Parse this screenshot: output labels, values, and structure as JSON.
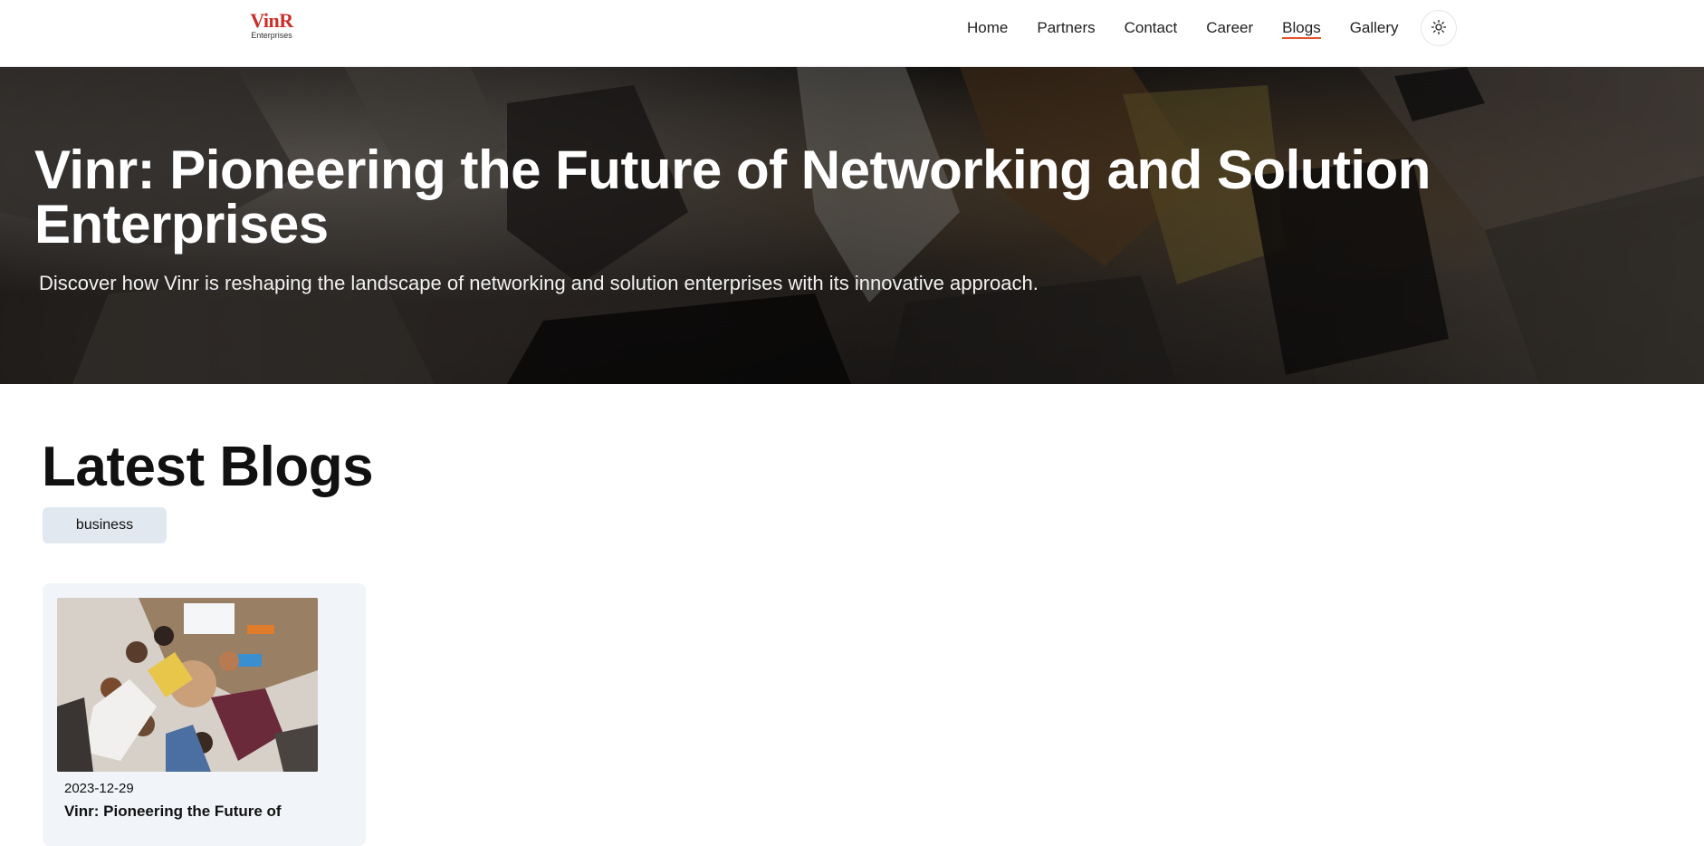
{
  "header": {
    "logo": {
      "main": "VinR",
      "sub": "Enterprises"
    },
    "nav": [
      {
        "label": "Home",
        "active": false
      },
      {
        "label": "Partners",
        "active": false
      },
      {
        "label": "Contact",
        "active": false
      },
      {
        "label": "Career",
        "active": false
      },
      {
        "label": "Blogs",
        "active": true
      },
      {
        "label": "Gallery",
        "active": false
      }
    ],
    "theme_toggle_icon": "sun-icon",
    "accent_color": "#e8532e"
  },
  "hero": {
    "title": "Vinr: Pioneering the Future of Networking and Solution Enterprises",
    "subtitle": "Discover how Vinr is reshaping the landscape of networking and solution enterprises with its innovative approach."
  },
  "latest": {
    "title": "Latest Blogs",
    "tags": [
      "business"
    ],
    "cards": [
      {
        "date": "2023-12-29",
        "title": "Vinr: Pioneering the Future of"
      }
    ]
  }
}
